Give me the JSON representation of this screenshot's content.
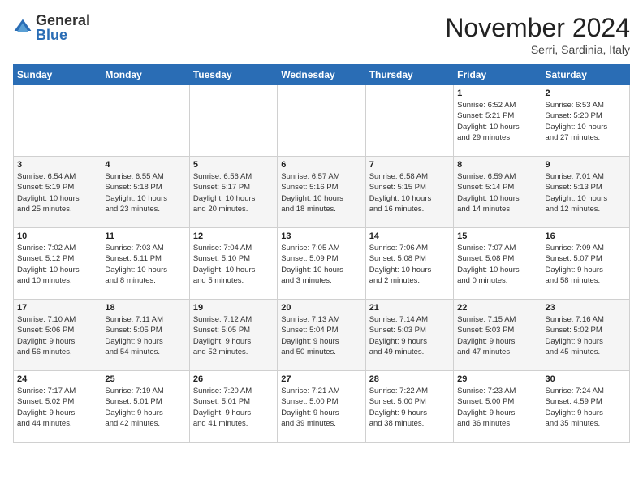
{
  "header": {
    "logo_general": "General",
    "logo_blue": "Blue",
    "month_title": "November 2024",
    "location": "Serri, Sardinia, Italy"
  },
  "days_of_week": [
    "Sunday",
    "Monday",
    "Tuesday",
    "Wednesday",
    "Thursday",
    "Friday",
    "Saturday"
  ],
  "weeks": [
    [
      {
        "day": "",
        "info": ""
      },
      {
        "day": "",
        "info": ""
      },
      {
        "day": "",
        "info": ""
      },
      {
        "day": "",
        "info": ""
      },
      {
        "day": "",
        "info": ""
      },
      {
        "day": "1",
        "info": "Sunrise: 6:52 AM\nSunset: 5:21 PM\nDaylight: 10 hours\nand 29 minutes."
      },
      {
        "day": "2",
        "info": "Sunrise: 6:53 AM\nSunset: 5:20 PM\nDaylight: 10 hours\nand 27 minutes."
      }
    ],
    [
      {
        "day": "3",
        "info": "Sunrise: 6:54 AM\nSunset: 5:19 PM\nDaylight: 10 hours\nand 25 minutes."
      },
      {
        "day": "4",
        "info": "Sunrise: 6:55 AM\nSunset: 5:18 PM\nDaylight: 10 hours\nand 23 minutes."
      },
      {
        "day": "5",
        "info": "Sunrise: 6:56 AM\nSunset: 5:17 PM\nDaylight: 10 hours\nand 20 minutes."
      },
      {
        "day": "6",
        "info": "Sunrise: 6:57 AM\nSunset: 5:16 PM\nDaylight: 10 hours\nand 18 minutes."
      },
      {
        "day": "7",
        "info": "Sunrise: 6:58 AM\nSunset: 5:15 PM\nDaylight: 10 hours\nand 16 minutes."
      },
      {
        "day": "8",
        "info": "Sunrise: 6:59 AM\nSunset: 5:14 PM\nDaylight: 10 hours\nand 14 minutes."
      },
      {
        "day": "9",
        "info": "Sunrise: 7:01 AM\nSunset: 5:13 PM\nDaylight: 10 hours\nand 12 minutes."
      }
    ],
    [
      {
        "day": "10",
        "info": "Sunrise: 7:02 AM\nSunset: 5:12 PM\nDaylight: 10 hours\nand 10 minutes."
      },
      {
        "day": "11",
        "info": "Sunrise: 7:03 AM\nSunset: 5:11 PM\nDaylight: 10 hours\nand 8 minutes."
      },
      {
        "day": "12",
        "info": "Sunrise: 7:04 AM\nSunset: 5:10 PM\nDaylight: 10 hours\nand 5 minutes."
      },
      {
        "day": "13",
        "info": "Sunrise: 7:05 AM\nSunset: 5:09 PM\nDaylight: 10 hours\nand 3 minutes."
      },
      {
        "day": "14",
        "info": "Sunrise: 7:06 AM\nSunset: 5:08 PM\nDaylight: 10 hours\nand 2 minutes."
      },
      {
        "day": "15",
        "info": "Sunrise: 7:07 AM\nSunset: 5:08 PM\nDaylight: 10 hours\nand 0 minutes."
      },
      {
        "day": "16",
        "info": "Sunrise: 7:09 AM\nSunset: 5:07 PM\nDaylight: 9 hours\nand 58 minutes."
      }
    ],
    [
      {
        "day": "17",
        "info": "Sunrise: 7:10 AM\nSunset: 5:06 PM\nDaylight: 9 hours\nand 56 minutes."
      },
      {
        "day": "18",
        "info": "Sunrise: 7:11 AM\nSunset: 5:05 PM\nDaylight: 9 hours\nand 54 minutes."
      },
      {
        "day": "19",
        "info": "Sunrise: 7:12 AM\nSunset: 5:05 PM\nDaylight: 9 hours\nand 52 minutes."
      },
      {
        "day": "20",
        "info": "Sunrise: 7:13 AM\nSunset: 5:04 PM\nDaylight: 9 hours\nand 50 minutes."
      },
      {
        "day": "21",
        "info": "Sunrise: 7:14 AM\nSunset: 5:03 PM\nDaylight: 9 hours\nand 49 minutes."
      },
      {
        "day": "22",
        "info": "Sunrise: 7:15 AM\nSunset: 5:03 PM\nDaylight: 9 hours\nand 47 minutes."
      },
      {
        "day": "23",
        "info": "Sunrise: 7:16 AM\nSunset: 5:02 PM\nDaylight: 9 hours\nand 45 minutes."
      }
    ],
    [
      {
        "day": "24",
        "info": "Sunrise: 7:17 AM\nSunset: 5:02 PM\nDaylight: 9 hours\nand 44 minutes."
      },
      {
        "day": "25",
        "info": "Sunrise: 7:19 AM\nSunset: 5:01 PM\nDaylight: 9 hours\nand 42 minutes."
      },
      {
        "day": "26",
        "info": "Sunrise: 7:20 AM\nSunset: 5:01 PM\nDaylight: 9 hours\nand 41 minutes."
      },
      {
        "day": "27",
        "info": "Sunrise: 7:21 AM\nSunset: 5:00 PM\nDaylight: 9 hours\nand 39 minutes."
      },
      {
        "day": "28",
        "info": "Sunrise: 7:22 AM\nSunset: 5:00 PM\nDaylight: 9 hours\nand 38 minutes."
      },
      {
        "day": "29",
        "info": "Sunrise: 7:23 AM\nSunset: 5:00 PM\nDaylight: 9 hours\nand 36 minutes."
      },
      {
        "day": "30",
        "info": "Sunrise: 7:24 AM\nSunset: 4:59 PM\nDaylight: 9 hours\nand 35 minutes."
      }
    ]
  ]
}
